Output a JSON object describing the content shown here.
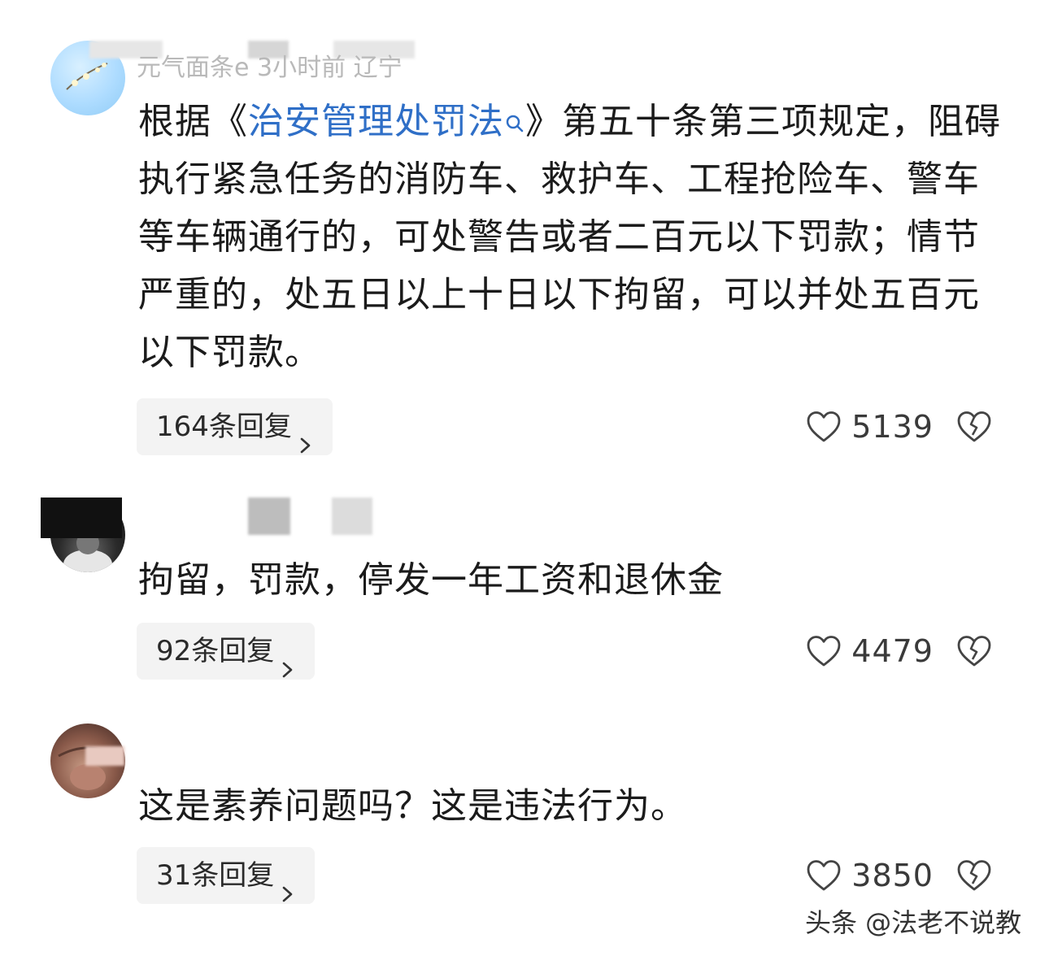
{
  "comments": [
    {
      "meta": "元气面条e  3小时前  辽宁",
      "text_before": "根据《",
      "link": "治安管理处罚法",
      "text_after": "》第五十条第三项规定，阻碍执行紧急任务的消防车、救护车、工程抢险车、警车等车辆通行的，可处警告或者二百元以下罚款；情节严重的，处五日以上十日以下拘留，可以并处五百元以下罚款。",
      "reply_label": "164条回复",
      "likes": "5139"
    },
    {
      "meta": "",
      "text": "拘留，罚款，停发一年工资和退休金",
      "reply_label": "92条回复",
      "likes": "4479"
    },
    {
      "meta": "",
      "text": "这是素养问题吗？这是违法行为。",
      "reply_label": "31条回复",
      "likes": "3850"
    }
  ],
  "watermark": "头条 @法老不说教",
  "icons": {
    "like": "heart-outline-icon",
    "dislike": "broken-heart-icon",
    "search": "search-icon",
    "chevron": "chevron-right-icon"
  },
  "colors": {
    "link": "#2f6fc7",
    "reply_bg": "#f3f3f3",
    "meta": "#b9b9b9"
  }
}
